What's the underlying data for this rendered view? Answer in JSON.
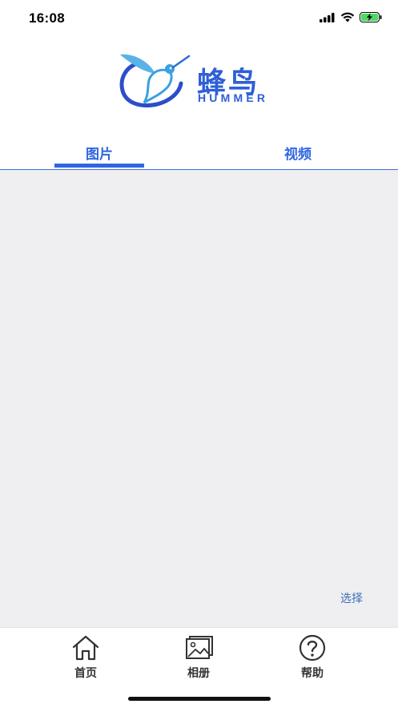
{
  "status_bar": {
    "time": "16:08"
  },
  "brand": {
    "name_cn": "蜂鸟",
    "name_en": "HUMMER",
    "color": "#2f5fd6"
  },
  "tabs": [
    {
      "label": "图片",
      "active": true
    },
    {
      "label": "视频",
      "active": false
    }
  ],
  "content": {
    "select_label": "选择"
  },
  "tabbar": {
    "items": [
      {
        "label": "首页",
        "icon": "home-icon"
      },
      {
        "label": "相册",
        "icon": "album-icon"
      },
      {
        "label": "帮助",
        "icon": "help-icon"
      }
    ]
  },
  "colors": {
    "accent": "#2f66e0",
    "content_bg": "#efeff1",
    "battery": "#4cd964"
  }
}
